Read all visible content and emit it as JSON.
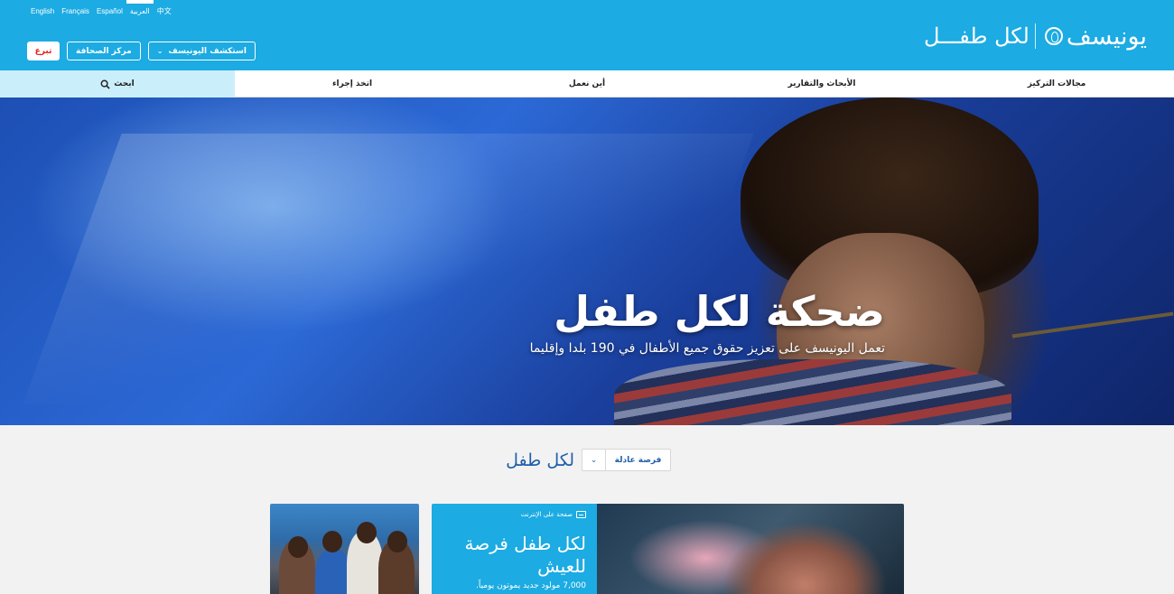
{
  "languages": [
    "English",
    "Français",
    "Español",
    "العربية",
    "中文"
  ],
  "active_language_index": 3,
  "header": {
    "donate_label": "تبرع",
    "press_label": "مركز الصحافة",
    "explore_label": "استكشف اليونيسف",
    "logo_org": "يونيسف",
    "logo_tagline": "لكل طفـــل"
  },
  "nav": {
    "search_label": "ابحث",
    "items": [
      "مجالات التركيز",
      "الأبحاث والتقارير",
      "أين نعمل",
      "اتخذ إجراء"
    ]
  },
  "hero": {
    "title": "ضحكة لكل طفل",
    "subtitle": "تعمل اليونيسف على تعزيز حقوق جميع الأطفال في 190 بلدا وإقليما"
  },
  "filter": {
    "heading": "لكل طفل",
    "selected": "فرصة عادلة"
  },
  "feature_card": {
    "tag": "صفحة على الإنترنت",
    "title": "لكل طفل فرصة للعيش",
    "description": "7,000 مولود جديد يموتون يومياً."
  },
  "colors": {
    "brand_blue": "#1cabe2",
    "search_bg": "#cbeefb",
    "donate_red": "#e2231a",
    "heading_blue": "#1f5fa8"
  }
}
